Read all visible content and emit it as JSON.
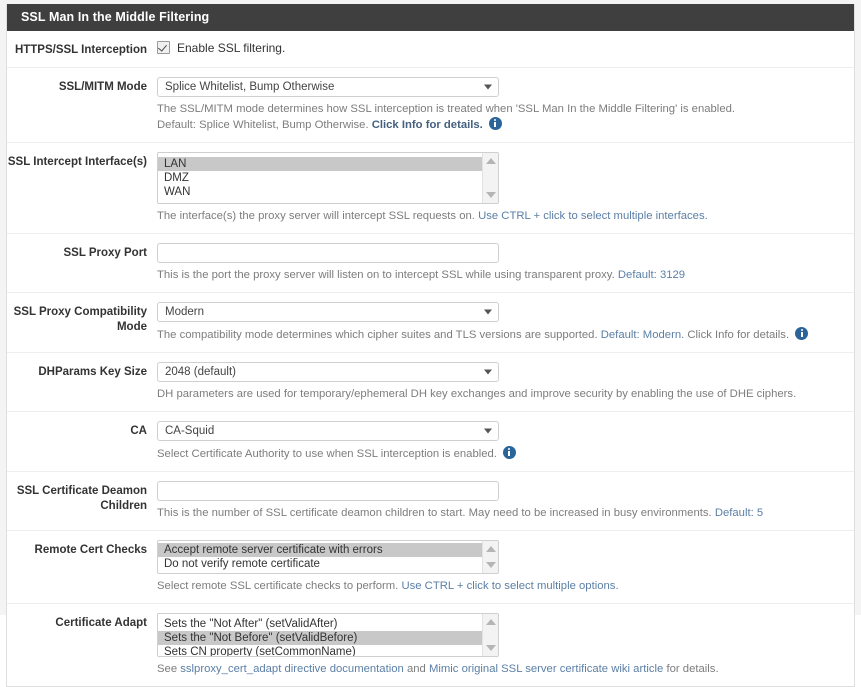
{
  "panel": {
    "title": "SSL Man In the Middle Filtering"
  },
  "rows": {
    "interception": {
      "label": "HTTPS/SSL Interception",
      "checkbox_label": "Enable SSL filtering.",
      "checked": true
    },
    "mitm_mode": {
      "label": "SSL/MITM Mode",
      "value": "Splice Whitelist, Bump Otherwise",
      "help_line1": "The SSL/MITM mode determines how SSL interception is treated when 'SSL Man In the Middle Filtering' is enabled.",
      "help_line2_plain": "Default: Splice Whitelist, Bump Otherwise. ",
      "help_line2_link": "Click Info for details.",
      "info_icon": "info-icon"
    },
    "intercept_interfaces": {
      "label": "SSL Intercept Interface(s)",
      "options": [
        "LAN",
        "DMZ",
        "WAN"
      ],
      "selected": [
        "LAN"
      ],
      "help_plain": "The interface(s) the proxy server will intercept SSL requests on. ",
      "help_link": "Use CTRL + click to select multiple interfaces."
    },
    "proxy_port": {
      "label": "SSL Proxy Port",
      "value": "",
      "placeholder": "",
      "help_plain": "This is the port the proxy server will listen on to intercept SSL while using transparent proxy. ",
      "help_link": "Default: 3129"
    },
    "compat_mode": {
      "label": "SSL Proxy Compatibility Mode",
      "value": "Modern",
      "help_plain_1": "The compatibility mode determines which cipher suites and TLS versions are supported. ",
      "help_link": "Default: Modern.",
      "help_plain_2": " Click Info for details.",
      "info_icon": "info-icon"
    },
    "dhparams": {
      "label": "DHParams Key Size",
      "value": "2048 (default)",
      "help": "DH parameters are used for temporary/ephemeral DH key exchanges and improve security by enabling the use of DHE ciphers."
    },
    "ca": {
      "label": "CA",
      "value": "CA-Squid",
      "help": "Select Certificate Authority to use when SSL interception is enabled.",
      "info_icon": "info-icon"
    },
    "cert_daemon_children": {
      "label": "SSL Certificate Deamon Children",
      "value": "",
      "placeholder": "",
      "help_plain": "This is the number of SSL certificate deamon children to start. May need to be increased in busy environments. ",
      "help_link": "Default: 5"
    },
    "remote_cert_checks": {
      "label": "Remote Cert Checks",
      "options": [
        "Accept remote server certificate with errors",
        "Do not verify remote certificate"
      ],
      "selected": [
        "Accept remote server certificate with errors"
      ],
      "help_plain": "Select remote SSL certificate checks to perform. ",
      "help_link": "Use CTRL + click to select multiple options."
    },
    "certificate_adapt": {
      "label": "Certificate Adapt",
      "options": [
        "Sets the \"Not After\" (setValidAfter)",
        "Sets the \"Not Before\" (setValidBefore)",
        "Sets CN property (setCommonName)"
      ],
      "selected": [
        "Sets the \"Not Before\" (setValidBefore)"
      ],
      "help_plain_1": "See ",
      "help_link_1": "sslproxy_cert_adapt directive documentation",
      "help_plain_2": " and ",
      "help_link_2": "Mimic original SSL server certificate wiki article",
      "help_plain_3": " for details."
    }
  },
  "colors": {
    "panel_header_bg": "#3f3f3f",
    "accent_link": "#5b7fa6",
    "info_icon": "#2b6499",
    "selected_option_bg": "#c8c8c8"
  }
}
